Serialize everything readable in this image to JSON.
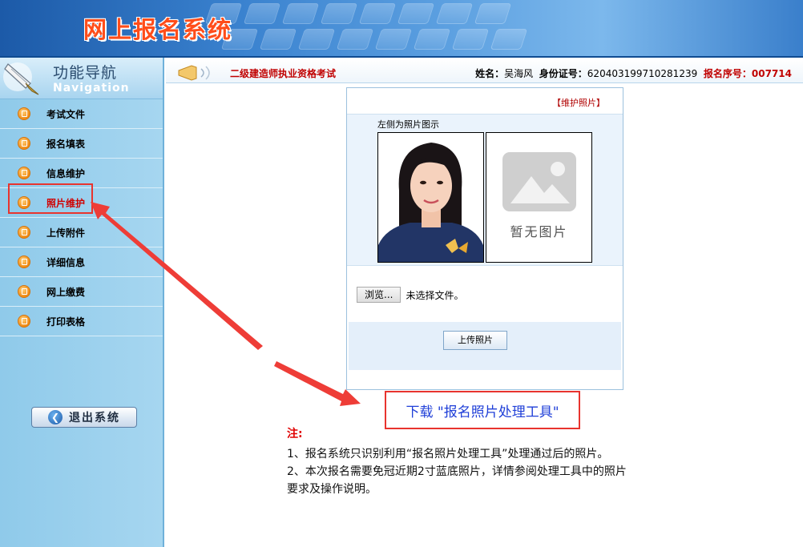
{
  "header": {
    "system_title": "网上报名系统"
  },
  "sidebar": {
    "nav_title_cn": "功能导航",
    "nav_title_en": "Navigation",
    "items": [
      {
        "label": "考试文件"
      },
      {
        "label": "报名填表"
      },
      {
        "label": "信息维护"
      },
      {
        "label": "照片维护"
      },
      {
        "label": "上传附件"
      },
      {
        "label": "详细信息"
      },
      {
        "label": "网上缴费"
      },
      {
        "label": "打印表格"
      }
    ],
    "active_item": "照片维护",
    "logout_label": "退出系统"
  },
  "infobar": {
    "exam_name": "二级建造师执业资格考试",
    "name_label": "姓名：",
    "name_value": "吴海风",
    "id_label": "身份证号：",
    "id_value": "620403199710281239",
    "reg_label": "报名序号：",
    "reg_value": "007714"
  },
  "photo_panel": {
    "maintain_link": "【维护照片】",
    "sample_caption": "左侧为照片图示",
    "no_photo_text": "暂无图片",
    "browse_label": "浏览...",
    "file_status": "未选择文件。",
    "upload_label": "上传照片"
  },
  "download": {
    "link_text": "下载 \"报名照片处理工具\""
  },
  "notes": {
    "heading": "注:",
    "line1": "1、报名系统只识别利用“报名照片处理工具”处理通过后的照片。",
    "line2a": "2、本次报名需要免冠近期2寸蓝底照片，详情参阅处理工具中的照片",
    "line2b": "要求及操作说明。"
  },
  "colors": {
    "annotation_red": "#e8342e",
    "link_blue": "#1f3fd8",
    "alert_red": "#c00000"
  }
}
